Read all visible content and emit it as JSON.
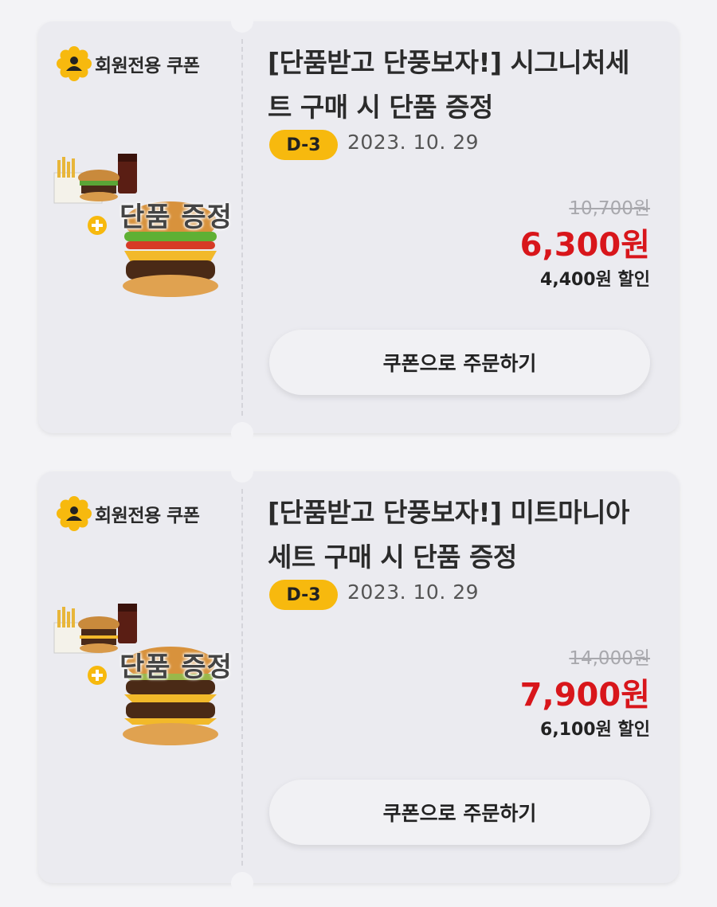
{
  "coupons": [
    {
      "badge": "회원전용 쿠폰",
      "badge_icon": "member-person-icon",
      "product_label": "단품 증정",
      "title": "[단품받고 단풍보자!] 시그니처세트 구매 시 단품 증정",
      "dday": "D-3",
      "date": "2023. 10. 29",
      "original_price": "10,700원",
      "final_price": "6,300원",
      "discount": "4,400원 할인",
      "order_button": "쿠폰으로 주문하기"
    },
    {
      "badge": "회원전용 쿠폰",
      "badge_icon": "member-person-icon",
      "product_label": "단품 증정",
      "title": "[단품받고 단풍보자!] 미트마니아세트 구매 시 단품 증정",
      "dday": "D-3",
      "date": "2023. 10. 29",
      "original_price": "14,000원",
      "final_price": "7,900원",
      "discount": "6,100원 할인",
      "order_button": "쿠폰으로 주문하기"
    }
  ],
  "colors": {
    "accent_yellow": "#f7b90e",
    "price_red": "#d8161b",
    "card_bg": "#ebebf0"
  }
}
